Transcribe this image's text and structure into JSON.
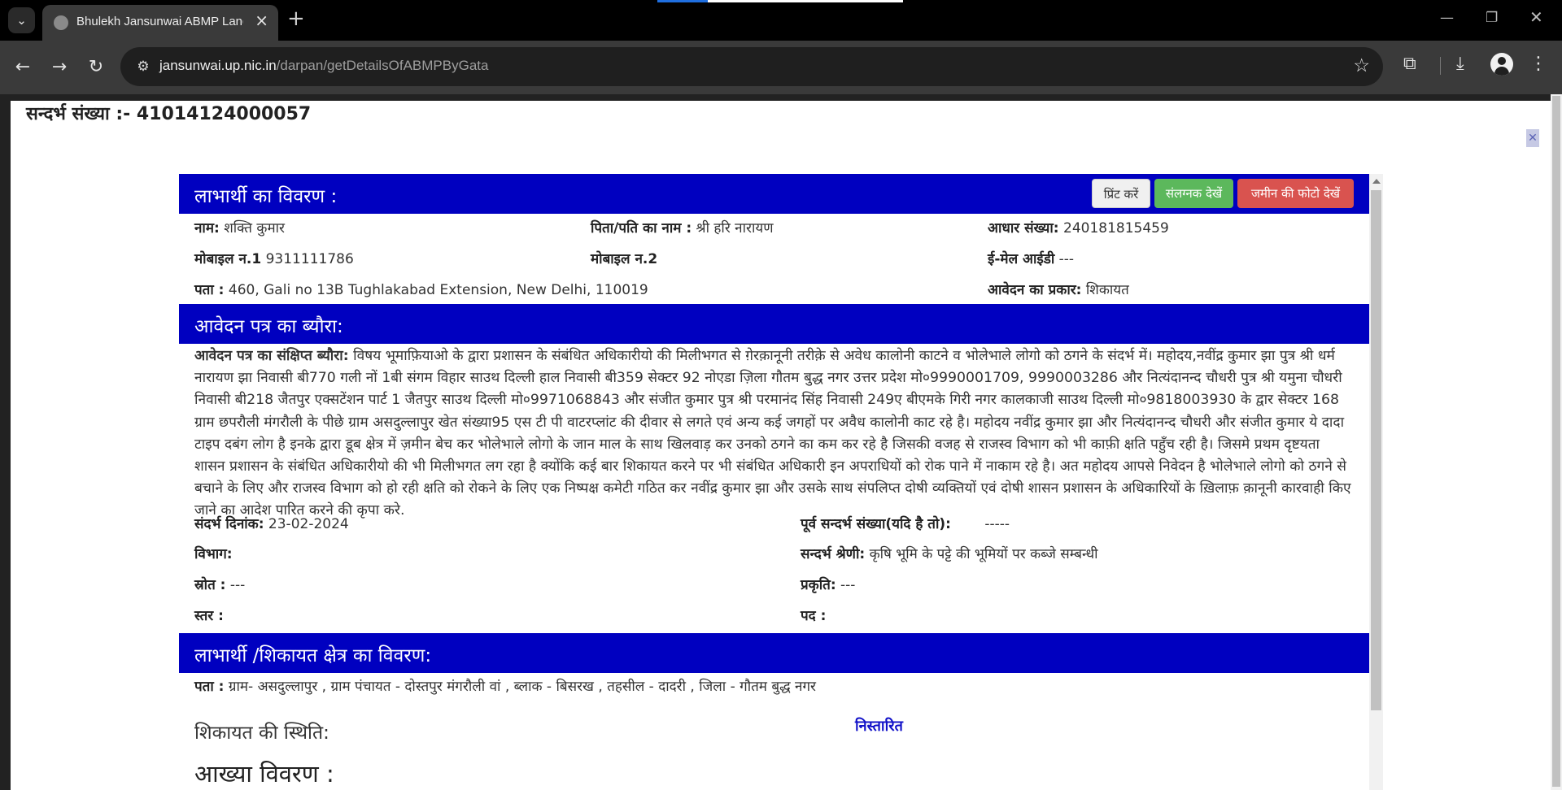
{
  "browser": {
    "tab_title": "Bhulekh Jansunwai ABMP Land",
    "url_host": "jansunwai.up.nic.in",
    "url_path": "/darpan/getDetailsOfABMPByGata"
  },
  "modal": {
    "title": "सन्दर्भ संख्या :- 41014124000057"
  },
  "beneficiary": {
    "header": "लाभार्थी का विवरण :",
    "buttons": {
      "print": "प्रिंट करें",
      "attachment": "संलग्नक देखें",
      "land_photo": "जमीन की फोटो देखें"
    },
    "name_label": "नाम:",
    "name": "शक्ति कुमार",
    "father_label": "पिता/पति का नाम :",
    "father": "श्री हरि नारायण",
    "aadhaar_label": "आधार संख्या:",
    "aadhaar": "240181815459",
    "mobile1_label": "मोबाइल न.1",
    "mobile1": "9311111786",
    "mobile2_label": "मोबाइल न.2",
    "mobile2": "",
    "email_label": "ई-मेल आईडी",
    "email": "---",
    "address_label": "पता :",
    "address": "460, Gali no 13B Tughlakabad Extension, New Delhi, 110019",
    "app_type_label": "आवेदन का प्रकार:",
    "app_type": "शिकायत"
  },
  "application": {
    "header": "आवेदन पत्र का ब्यौरा:",
    "summary_label": "आवेदन पत्र का संक्षिप्त ब्यौरा:",
    "summary": "विषय भूमाफ़ियाओ के द्वारा प्रशासन के संबंधित अधिकारीयो की मिलीभगत से ग़ेरक़ानूनी तरीक़े से अवेध कालोनी काटने व भोलेभाले लोगो को ठगने के संदर्भ में। महोदय,नवींद्र कुमार झा पुत्र श्री धर्म नारायण झा निवासी बी770 गली नों 1बी संगम विहार साउथ दिल्ली हाल निवासी बी359 सेक्टर 92 नोएडा ज़िला गौतम बुद्ध नगर उत्तर प्रदेश मो०9990001709, 9990003286 और नित्यंदानन्द चौधरी पुत्र श्री यमुना चौधरी निवासी बी218 जैतपुर एक्सटेंशन पार्ट 1 जैतपुर साउथ दिल्ली मो०9971068843 और संजीत कुमार पुत्र श्री परमानंद सिंह निवासी 249ए बीएमके गिरी नगर कालकाजी साउथ दिल्ली मो०9818003930 के द्वार सेक्टर 168 ग्राम छपरौली मंगरौली के पीछे ग्राम असदुल्लापुर खेत संख्या95 एस टी पी वाटरप्लांट की दीवार से लगते एवं अन्य कई जगहों पर अवैध कालोनी काट रहे है। महोदय नवींद्र कुमार झा और नित्यंदानन्द चौधरी और संजीत कुमार ये दादा टाइप दबंग लोग है इनके द्वारा डूब क्षेत्र में ज़मीन बेच कर भोलेभाले लोगो के जान माल के साथ खिलवाड़ कर उनको ठगने का कम कर रहे है जिसकी वजह से राजस्व विभाग को भी काफ़ी क्षति पहुँच रही है। जिसमे प्रथम दृष्टयता शासन प्रशासन के संबंधित अधिकारीयो की भी मिलीभगत लग रहा है क्योंकि कई बार शिकायत करने पर भी संबंधित अधिकारी इन अपराधियों को रोक पाने में नाकाम रहे है। अत महोदय आपसे निवेदन है भोलेभाले लोगो को ठगने से बचाने के लिए और राजस्व विभाग को हो रही क्षति को रोकने के लिए एक निष्पक्ष कमेटी गठित कर नवींद्र कुमार झा और उसके साथ संपलिप्त दोषी व्यक्तियों एवं दोषी शासन प्रशासन के अधिकारियों के ख़िलाफ़ क़ानूनी कारवाही किए जाने का आदेश पारित करने की कृपा करे.",
    "ref_date_label": "संदर्भ दिनांक:",
    "ref_date": "23-02-2024",
    "prev_ref_label": "पूर्व सन्दर्भ संख्या(यदि है तो):",
    "prev_ref": "-----",
    "department_label": "विभाग:",
    "department": "",
    "category_label": "सन्दर्भ श्रेणी:",
    "category": "कृषि भूमि के पट्टे की भूमियों पर कब्जे सम्बन्धी",
    "source_label": "स्रोत :",
    "source": "---",
    "nature_label": "प्रकृति:",
    "nature": "---",
    "level_label": "स्तर :",
    "level": "",
    "post_label": "पद :",
    "post": ""
  },
  "area": {
    "header": "लाभार्थी /शिकायत क्षेत्र का विवरण:",
    "address_label": "पता :",
    "address": "ग्राम- असदुल्लापुर , ग्राम पंचायत - दोस्तपुर मंगरौली वां , ब्लाक - बिसरख , तहसील - दादरी , जिला - गौतम बुद्ध नगर"
  },
  "status": {
    "label": "शिकायत की स्थिति:",
    "value": "निस्तारित",
    "detail_heading": "आख्या विवरण :"
  },
  "colors": {
    "section_header": "#0000c0",
    "button_success": "#5cb85c",
    "button_danger": "#d9534f",
    "status_value": "#1010c8"
  }
}
